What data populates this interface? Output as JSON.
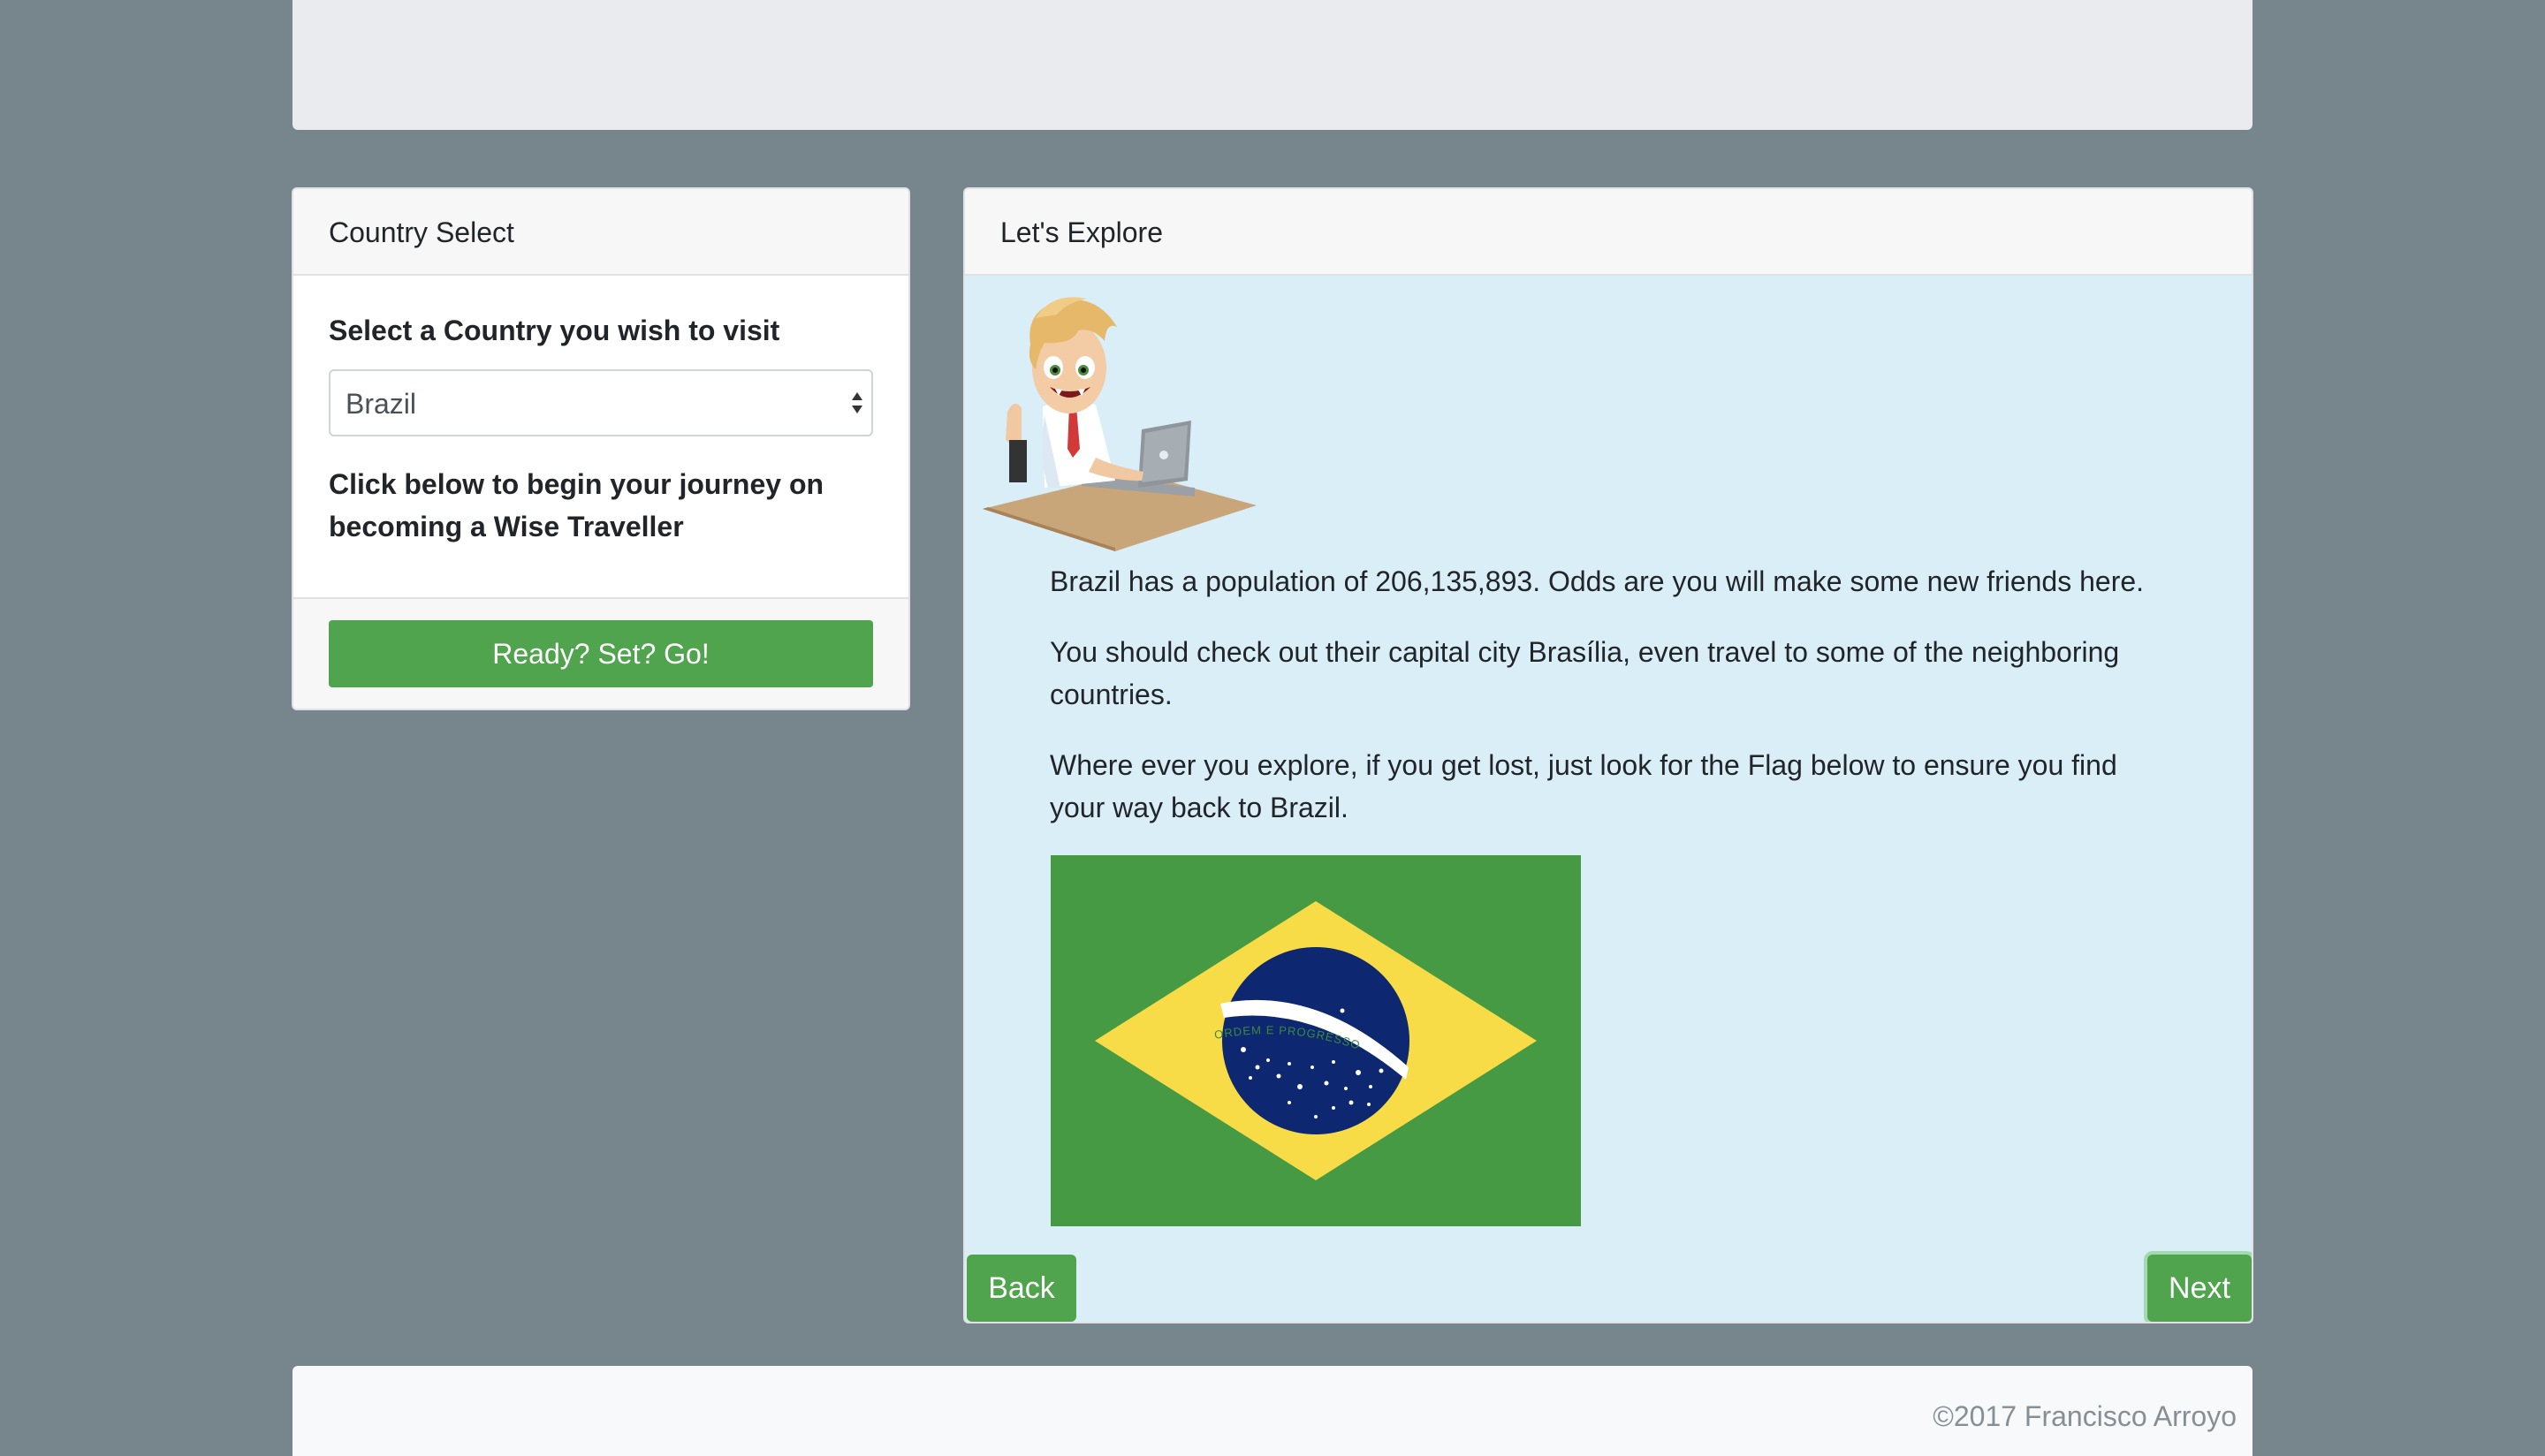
{
  "left_card": {
    "header": "Country Select",
    "select_label": "Select a Country you wish to visit",
    "selected_country": "Brazil",
    "journey_text": "Click below to begin your journey on becoming a Wise Traveller",
    "go_button_label": "Ready? Set? Go!"
  },
  "right_card": {
    "header": "Let's Explore",
    "paragraphs": {
      "population": "Brazil has a population of 206,135,893. Odds are you will make some new friends here.",
      "capital": "You should check out their capital city Brasília, even travel to some of the neighboring countries.",
      "flag": "Where ever you explore, if you get lost, just look for the Flag below to ensure you find your way back to Brazil."
    },
    "flag_motto": "ORDEM E PROGRESSO",
    "back_label": "Back",
    "next_label": "Next"
  },
  "footer": {
    "copyright": "©2017 Francisco Arroyo"
  },
  "colors": {
    "page_background": "#77858d",
    "button_green": "#51a44e",
    "explore_background": "#d9eef7",
    "flag_green": "#469a44",
    "flag_yellow": "#f7db47",
    "flag_blue": "#0d2770"
  },
  "icons": {
    "select": "select-arrows-icon",
    "character": "traveller-character-illustration",
    "flag": "brazil-flag"
  }
}
